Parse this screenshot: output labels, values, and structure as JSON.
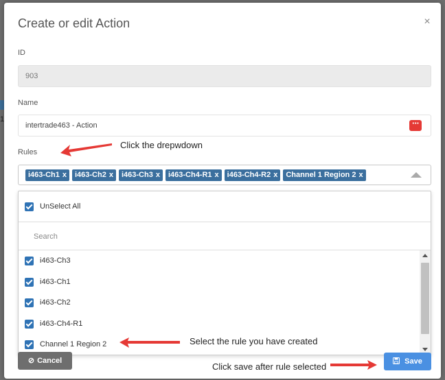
{
  "modal": {
    "title": "Create or edit Action",
    "close_icon": "×"
  },
  "fields": {
    "id_label": "ID",
    "id_value": "903",
    "name_label": "Name",
    "name_value": "intertrade463 - Action",
    "rules_label": "Rules"
  },
  "rules": {
    "selected_tags": [
      {
        "label": "i463-Ch1",
        "remove": "x"
      },
      {
        "label": "i463-Ch2",
        "remove": "x"
      },
      {
        "label": "i463-Ch3",
        "remove": "x"
      },
      {
        "label": "i463-Ch4-R1",
        "remove": "x"
      },
      {
        "label": "i463-Ch4-R2",
        "remove": "x"
      },
      {
        "label": "Channel 1 Region 2",
        "remove": "x"
      }
    ],
    "dropdown": {
      "unselect_all": "UnSelect All",
      "search_placeholder": "Search",
      "options": [
        {
          "label": "i463-Ch3",
          "checked": true
        },
        {
          "label": "i463-Ch1",
          "checked": true
        },
        {
          "label": "i463-Ch2",
          "checked": true
        },
        {
          "label": "i463-Ch4-R1",
          "checked": true
        },
        {
          "label": "Channel 1 Region 2",
          "checked": true
        }
      ]
    }
  },
  "buttons": {
    "cancel": "Cancel",
    "save": "Save"
  },
  "annotations": {
    "click_dropdown": "Click the drepwdown",
    "select_rule": "Select the rule you have created",
    "click_save": "Click save after rule selected"
  },
  "colors": {
    "tag": "#3b6f9e",
    "checkbox": "#2f73b5",
    "save_button": "#4a90e2",
    "cancel_button": "#6e6e6e",
    "arrow": "#e53935",
    "dots_button": "#e53935"
  },
  "icons": {
    "close": "close-icon",
    "dots": "dots-menu-icon",
    "cancel": "ban-icon",
    "save": "floppy-disk-icon",
    "caret": "caret-up-icon",
    "checkbox": "checkbox-checked-icon"
  }
}
